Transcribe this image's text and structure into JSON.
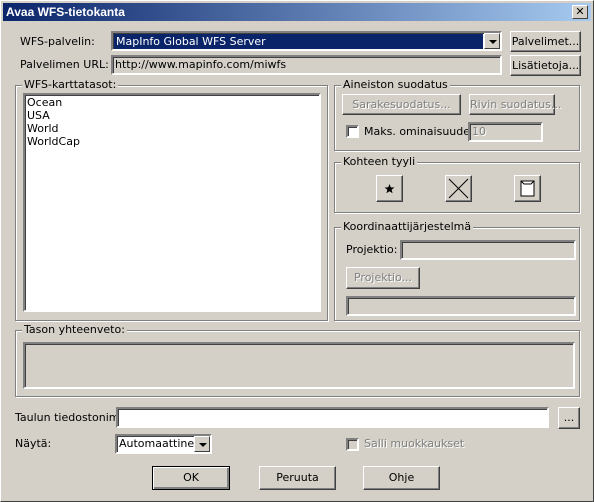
{
  "window": {
    "title": "Avaa WFS-tietokanta",
    "close_glyph": "✕"
  },
  "server": {
    "label": "WFS-palvelin:",
    "selected": "MapInfo Global WFS Server",
    "servers_button": "Palvelimet...",
    "url_label": "Palvelimen URL:",
    "url_value": "http://www.mapinfo.com/miwfs",
    "info_button": "Lisätietoja..."
  },
  "layers": {
    "label": "WFS-karttatasot:",
    "items": [
      "Ocean",
      "USA",
      "World",
      "WorldCap"
    ]
  },
  "filter": {
    "label": "Aineiston suodatus",
    "column_filter_button": "Sarakesuodatus...",
    "row_filter_button": "Rivin suodatus...",
    "max_features_label": "Maks. ominaisuudet",
    "max_features_checked": false,
    "max_features_value": "10"
  },
  "style": {
    "label": "Kohteen tyyli",
    "icons": [
      "symbol-style-icon",
      "line-style-icon",
      "region-style-icon"
    ]
  },
  "coords": {
    "label": "Koordinaattijärjestelmä",
    "projection_label": "Projektio:",
    "projection_value": "",
    "projection_button": "Projektio...",
    "detail_value": ""
  },
  "summary": {
    "label": "Tason yhteenveto:",
    "value": ""
  },
  "table": {
    "filename_label": "Taulun tiedostonimi:",
    "filename_value": "",
    "browse_button": "...",
    "show_label": "Näytä:",
    "show_value": "Automaattinen",
    "allow_edits_label": "Salli muokkaukset",
    "allow_edits_checked": false
  },
  "buttons": {
    "ok": "OK",
    "cancel": "Peruuta",
    "help": "Ohje"
  }
}
